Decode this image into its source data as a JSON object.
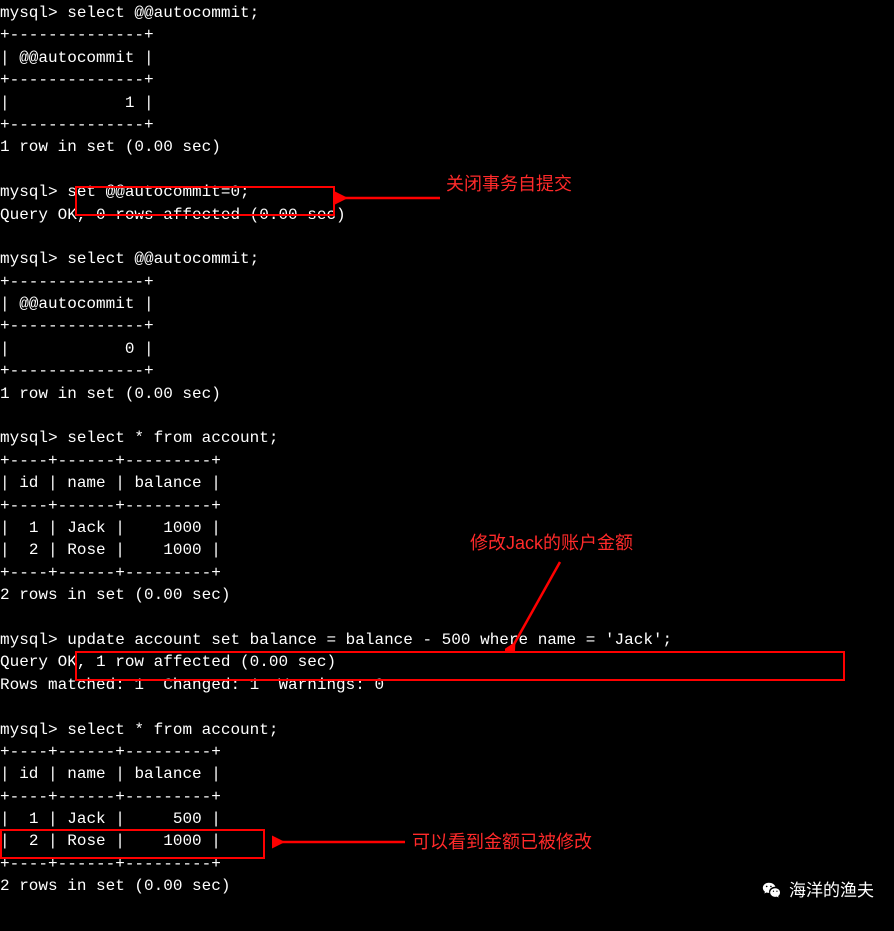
{
  "prompts": {
    "p1": "mysql>",
    "cmd1": "select @@autocommit;",
    "cmd2": "set @@autocommit=0;",
    "cmd3": "select @@autocommit;",
    "cmd4": "select * from account;",
    "cmd5": "update account set balance = balance - 500 where name = 'Jack';",
    "cmd6": "select * from account;"
  },
  "results": {
    "autocommit_header": "@@autocommit",
    "autocommit_1": "1",
    "autocommit_0": "0",
    "one_row": "1 row in set (0.00 sec)",
    "two_rows": "2 rows in set (0.00 sec)",
    "query_ok_0": "Query OK, 0 rows affected (0.00 sec)",
    "query_ok_1": "Query OK, 1 row affected (0.00 sec)",
    "rows_matched": "Rows matched: 1  Changed: 1  Warnings: 0"
  },
  "table": {
    "col_id": "id",
    "col_name": "name",
    "col_balance": "balance",
    "rows_before": [
      {
        "id": "1",
        "name": "Jack",
        "balance": "1000"
      },
      {
        "id": "2",
        "name": "Rose",
        "balance": "1000"
      }
    ],
    "rows_after": [
      {
        "id": "1",
        "name": "Jack",
        "balance": "500"
      },
      {
        "id": "2",
        "name": "Rose",
        "balance": "1000"
      }
    ]
  },
  "annotations": {
    "a1": "关闭事务自提交",
    "a2": "修改Jack的账户金额",
    "a3": "可以看到金额已被修改"
  },
  "watermark": "海洋的渔夫"
}
